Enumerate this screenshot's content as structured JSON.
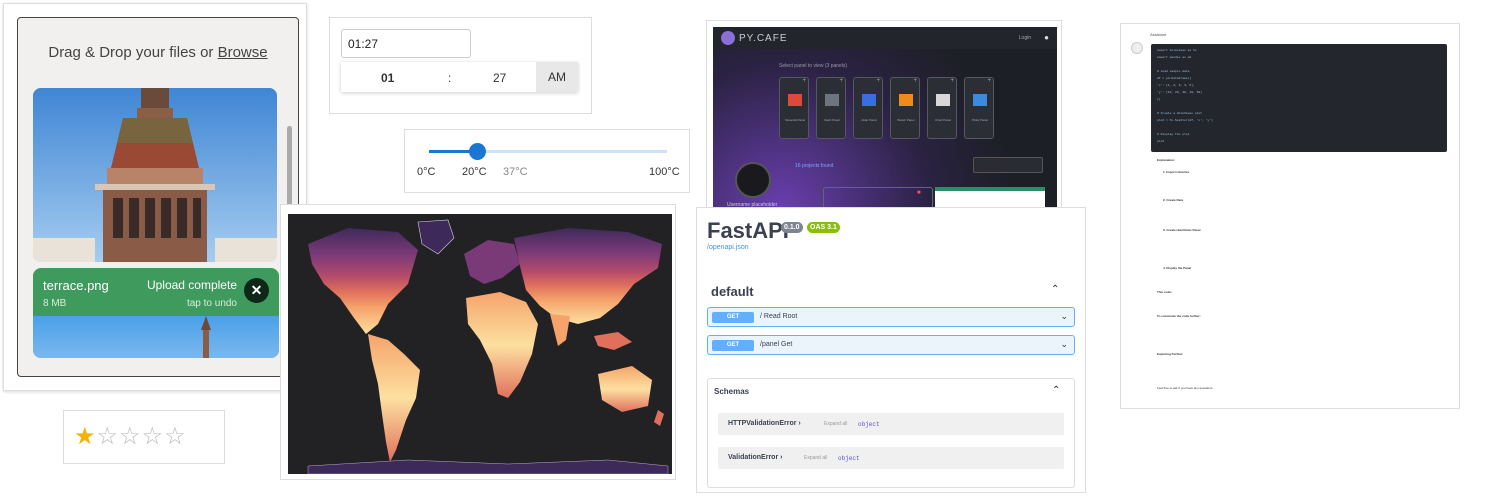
{
  "upload": {
    "drop_text": "Drag & Drop your files or",
    "browse_label": "Browse",
    "file": {
      "name": "terrace.png",
      "size": "8 MB",
      "status": "Upload complete",
      "undo": "tap to undo",
      "close_glyph": "✕"
    }
  },
  "rating": {
    "value": 1,
    "max": 5,
    "on_glyph": "★",
    "off_glyph": "☆"
  },
  "timepicker": {
    "value": "01:27",
    "hours": "01",
    "separator": ":",
    "minutes": "27",
    "period": "AM"
  },
  "slider": {
    "value_fraction": 0.2,
    "min_label": "0°C",
    "value_label": "20°C",
    "mid_label": "37°C",
    "max_label": "100°C"
  },
  "map": {
    "background": "#222225",
    "palette": [
      "#fde0a0",
      "#f5a36a",
      "#e0705c",
      "#b34a6b",
      "#7a3a78",
      "#3e2a5a"
    ]
  },
  "dashboard": {
    "brand": "PY.CAFE",
    "login": "Login",
    "subtitle": "Select panel to view (3 panels)",
    "panels": [
      "Streamlit Panel",
      "Dash Panel",
      "Altair Panel",
      "Bokeh Panel",
      "Chart Panel",
      "Plotly Panel"
    ],
    "found": "16 projects found",
    "user": "Username placeholder"
  },
  "fastapi": {
    "title": "FastAPI",
    "version_badge": "0.1.0",
    "oas_badge": "OAS 3.1",
    "docs_link": "/openapi.json",
    "section": "default",
    "operations": [
      {
        "method": "GET",
        "path": "/",
        "summary": "Read Root"
      },
      {
        "method": "GET",
        "path": "/panel",
        "summary": "Get"
      }
    ],
    "schemas_title": "Schemas",
    "schemas": [
      {
        "name": "HTTPValidationError",
        "expand": "Expand all",
        "type": "object"
      },
      {
        "name": "ValidationError",
        "expand": "Expand all",
        "type": "object"
      }
    ],
    "colors": {
      "get": "#61affe",
      "version": "#89bf04",
      "oas": "#89bf04"
    }
  },
  "chat": {
    "author": "Assistant",
    "code_lines": [
      "import holoviews as hv",
      "import pandas as pd",
      "",
      "# Load sample data",
      "df = pd.DataFrame({",
      "    'x': [1, 2, 3, 4, 5],",
      "    'y': [10, 20, 30, 40, 50]",
      "})",
      "",
      "# Create a HoloViews plot",
      "plot = hv.Scatter(df, 'x', 'y')",
      "",
      "# Display the plot",
      "plot"
    ],
    "explanation": "Explanation:",
    "steps": [
      "1. Import Libraries",
      "2. Create Data",
      "3. Create HoloViews Panel",
      "4. Display the Panel"
    ],
    "this_code": "This code:",
    "customize": "To customize the code further:",
    "exploring": "Exploring Further:",
    "footer": "Feel free to ask if you have any questions."
  }
}
